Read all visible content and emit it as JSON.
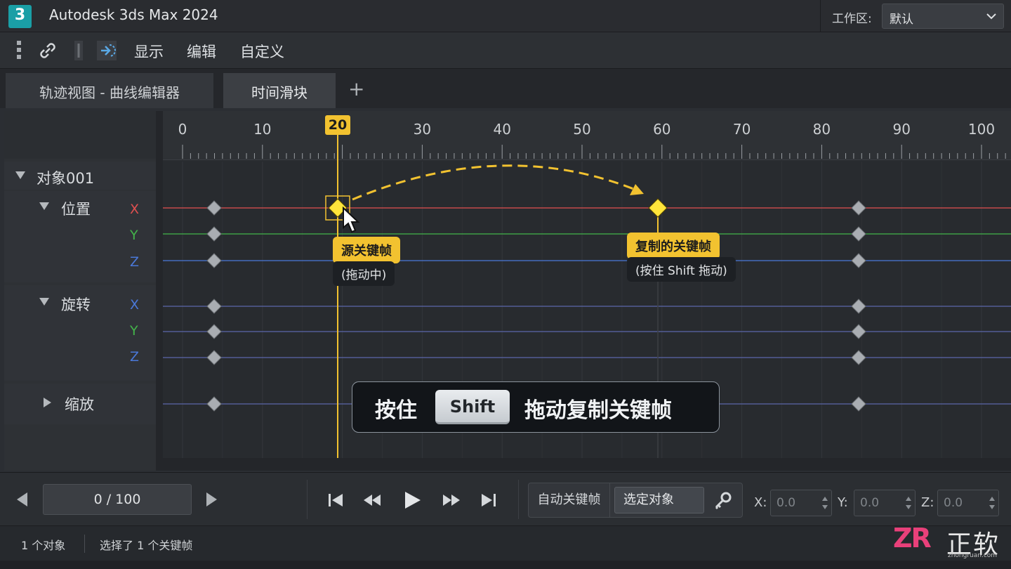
{
  "app": {
    "logo": "3",
    "title": "Autodesk 3ds Max 2024"
  },
  "workspace": {
    "label": "工作区:",
    "value": "默认"
  },
  "menu": {
    "items": [
      "显示",
      "编辑",
      "自定义"
    ]
  },
  "tabs": {
    "curve_editor": "轨迹视图 - 曲线编辑器",
    "time_slider": "时间滑块",
    "add": "+"
  },
  "ruler": {
    "ticks": [
      "0",
      "10",
      "20",
      "30",
      "40",
      "50",
      "60",
      "70",
      "80",
      "90",
      "100"
    ],
    "current_frame": "20"
  },
  "tree": {
    "object": "对象001",
    "position": "位置",
    "rotation": "旋转",
    "scale": "缩放",
    "axes": {
      "x": "X",
      "y": "Y",
      "z": "Z"
    }
  },
  "callouts": {
    "source_tag": "源关键帧",
    "source_sub": "(拖动中)",
    "copy_tag": "复制的关键帧",
    "copy_sub": "(按住 Shift 拖动)"
  },
  "hint": {
    "before": "按住",
    "key": "Shift",
    "after": "拖动复制关键帧"
  },
  "transport": {
    "frame": "0 / 100",
    "auto_key": "自动关键帧",
    "selected_object": "选定对象",
    "x_label": "X:",
    "y_label": "Y:",
    "z_label": "Z:",
    "x_value": "0.0",
    "y_value": "0.0",
    "z_value": "0.0"
  },
  "status": {
    "objects": "1 个对象",
    "keys": "选择了 1 个关键帧"
  },
  "watermark": {
    "brand": "ZR",
    "name": "正软",
    "url": "zhongruan.com"
  },
  "colors": {
    "accent": "#f2c230",
    "axis_x": "#e05050",
    "axis_y": "#43b34a",
    "axis_z": "#4a78d8",
    "track_line": "#5a66a8"
  }
}
